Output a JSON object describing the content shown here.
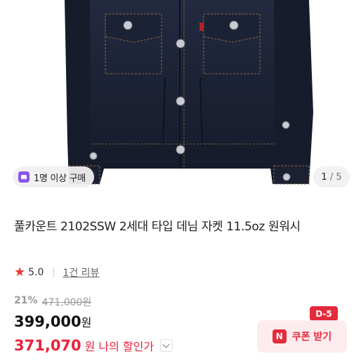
{
  "gallery": {
    "image_alt": "denim jacket product photo",
    "buyer_badge": "1명 이상 구매",
    "page_current": "1",
    "page_total": "/ 5"
  },
  "product": {
    "title": "풀카운트 2102SSW 2세대 타입 데님 자켓 11.5oz 원워시",
    "rating": "5.0",
    "reviews": "1건 리뷰"
  },
  "pricing": {
    "discount_rate": "21%",
    "original_price": "471,000원",
    "sale_price": "399,000",
    "sale_currency": "원",
    "my_price": "371,070",
    "my_currency": "원",
    "my_price_label": "나의 할인가"
  },
  "coupon": {
    "dday": "D-5",
    "icon_letter": "N",
    "label": "쿠폰 받기"
  },
  "colors": {
    "accent": "#e32b3c",
    "denim": "#1c2236"
  }
}
